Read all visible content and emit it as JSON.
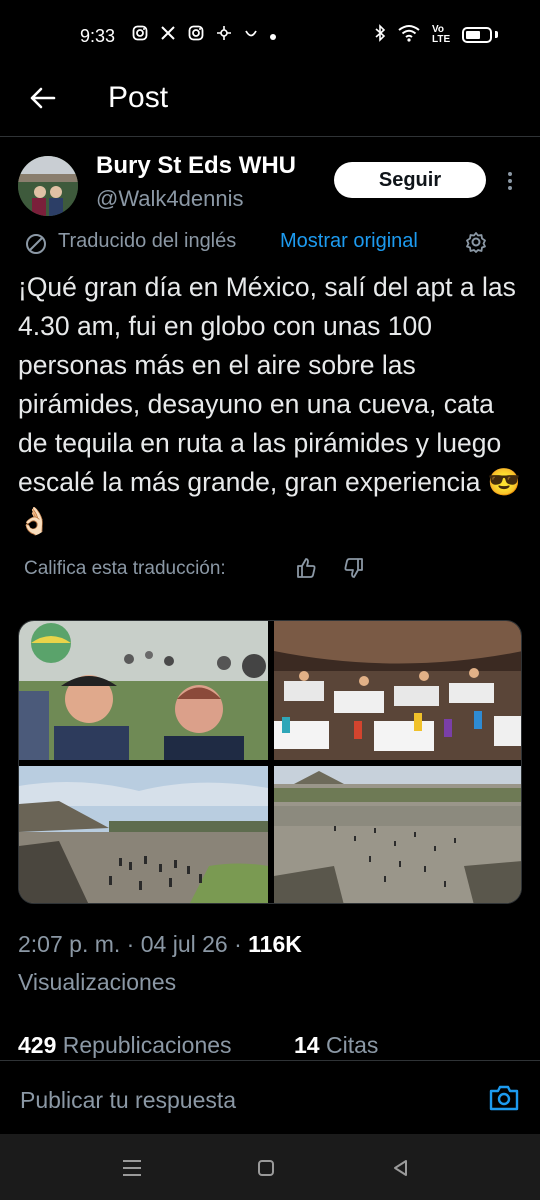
{
  "status_bar": {
    "time": "9:33",
    "left_icons": [
      "instagram-icon",
      "x-icon",
      "instagram-icon",
      "threads-icon",
      "notification-icon",
      "dot-icon"
    ],
    "right_icons": [
      "bluetooth-icon",
      "wifi-icon",
      "volte-icon",
      "battery-icon"
    ],
    "volte_label": "Vo LTE"
  },
  "nav": {
    "title": "Post",
    "back_icon": "arrow-left-icon"
  },
  "author": {
    "name": "Bury St Eds WHU",
    "handle": "@Walk4dennis",
    "follow_label": "Seguir",
    "more_icon": "more-vertical-icon"
  },
  "translation": {
    "label": "Traducido del inglés",
    "show_original": "Mostrar original",
    "icon": "translate-icon",
    "settings_icon": "gear-icon"
  },
  "post": {
    "text": "¡Qué gran día en México, salí del apt a las 4.30 am, fui en globo con unas 100 personas más en el aire sobre las pirámides, desayuno en una cueva, cata de tequila en ruta a las pirámides y luego escalé la más grande, gran experiencia 😎👌🏻"
  },
  "rating": {
    "label": "Califica esta traducción:",
    "up_icon": "thumbs-up-icon",
    "down_icon": "thumbs-down-icon"
  },
  "media": [
    {
      "description": "selfie-hot-air-balloons"
    },
    {
      "description": "cave-restaurant"
    },
    {
      "description": "pyramid-of-the-moon-plaza"
    },
    {
      "description": "avenue-of-the-dead-aerial"
    }
  ],
  "meta": {
    "time": "2:07 p. m.",
    "separator": " · ",
    "date": "04 jul 26",
    "views_count": "116K",
    "views_label": "Visualizaciones"
  },
  "stats": {
    "reposts_count": "429",
    "reposts_label": "Republicaciones",
    "quotes_count": "14",
    "quotes_label": "Citas"
  },
  "reply": {
    "placeholder": "Publicar tu respuesta",
    "camera_icon": "camera-icon"
  },
  "colors": {
    "background": "#000000",
    "text": "#e7e9ea",
    "secondary": "#8b98a5",
    "accent": "#1d9bf0",
    "divider": "#2f3336"
  }
}
